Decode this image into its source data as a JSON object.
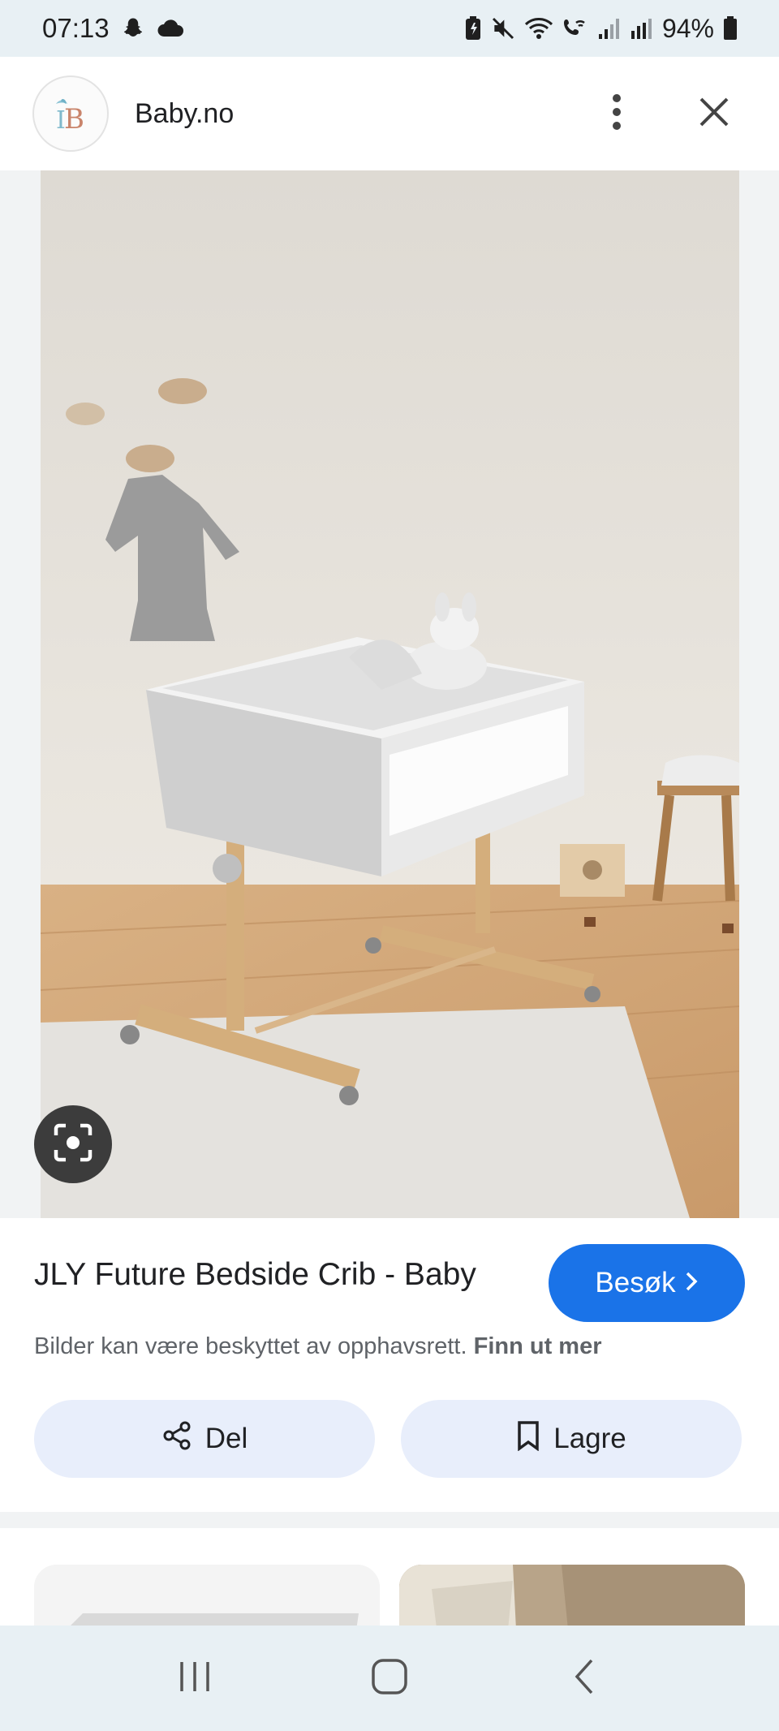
{
  "status_bar": {
    "time": "07:13",
    "battery_percent": "94%",
    "icons": [
      "snapchat-icon",
      "cloud-icon",
      "battery-saver-icon",
      "mute-icon",
      "wifi-icon",
      "wifi-call-icon",
      "signal-icon",
      "signal-r-icon",
      "battery-icon"
    ]
  },
  "header": {
    "site_name": "Baby.no",
    "logo_text": "B",
    "icons": [
      "more-vert-icon",
      "close-icon"
    ]
  },
  "image": {
    "description_icon": "image-crib-photo",
    "lens_icon": "lens-icon"
  },
  "result": {
    "title": "JLY Future Bedside Crib - Baby",
    "visit_label": "Besøk",
    "copyright_text": "Bilder kan være beskyttet av opphavsrett.",
    "learn_more": "Finn ut mer",
    "share_label": "Del",
    "save_label": "Lagre"
  },
  "colors": {
    "accent": "#1a73e8",
    "action_bg": "#e8eefb",
    "statusbar_bg": "#e8f0f4"
  }
}
